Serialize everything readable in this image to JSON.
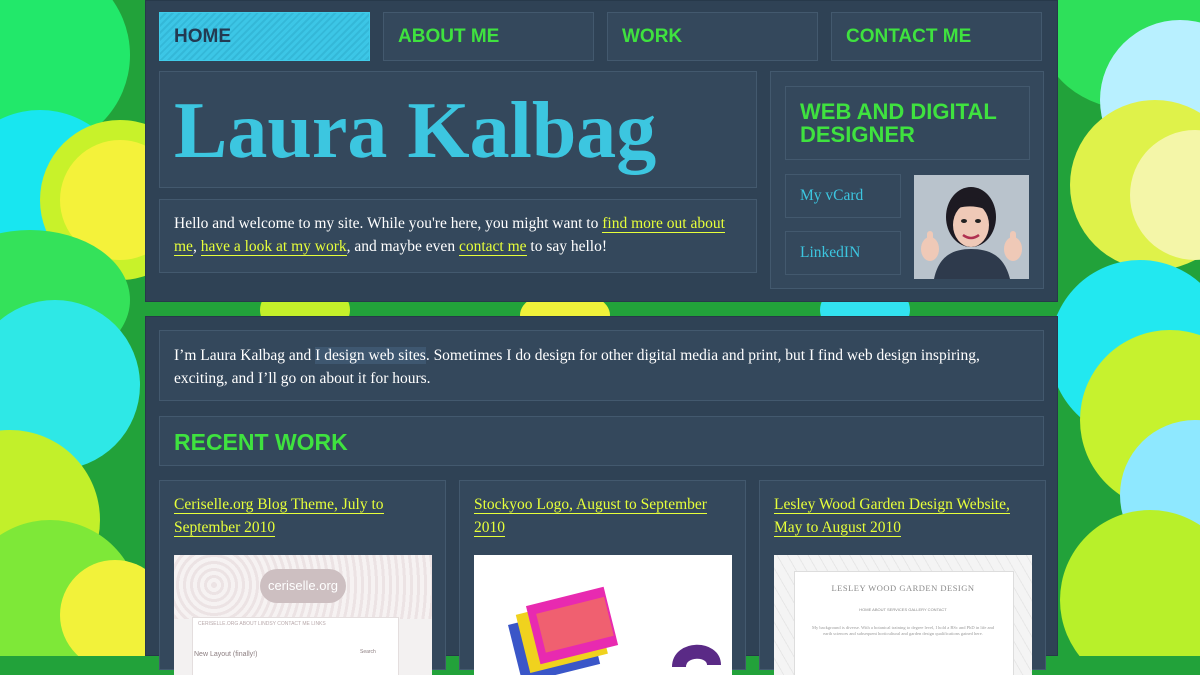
{
  "nav": {
    "home": "HOME",
    "about": "ABOUT ME",
    "work": "WORK",
    "contact": "CONTACT ME"
  },
  "header": {
    "name": "Laura Kalbag",
    "role": "WEB AND DIGITAL DESIGNER",
    "vcard": "My vCard",
    "linkedin": "LinkedIN"
  },
  "intro": {
    "t1": "Hello and welcome to my site. While you're here, you might want to ",
    "l1": "find more out about me",
    "t2": ", ",
    "l2": "have a look at my work",
    "t3": ", and maybe even ",
    "l3": "contact me",
    "t4": " to say hello!"
  },
  "about": {
    "t1": "I’m Laura Kalbag and ",
    "hl": "I design web sites",
    "t2": ". Sometimes I do design for other digital media and print, but I find web design inspiring, exciting, and I’ll go on about it for hours."
  },
  "recent_work": {
    "heading": "RECENT WORK",
    "items": [
      {
        "title": "Ceriselle.org Blog Theme, July to September 2010",
        "thumb_text": "ceriselle.org",
        "thumb_nav": "CERISELLE.ORG   ABOUT LINDSY   CONTACT ME   LINKS",
        "thumb_post": "New Layout (finally!)",
        "thumb_search": "Search"
      },
      {
        "title": "Stockyoo Logo, August to September 2010"
      },
      {
        "title": "Lesley Wood Garden Design Website, May to August 2010",
        "thumb_text": "LESLEY WOOD GARDEN DESIGN",
        "thumb_nav": "HOME    ABOUT    SERVICES    GALLERY    CONTACT",
        "thumb_body": "My background is diverse. With a botanical training to degree level, I hold a BSc and PhD in life and earth sciences and subsequent horticultural and garden design qualifications gained here."
      }
    ]
  },
  "colors": {
    "panel": "#2f4255",
    "green_accent": "#3fe23f",
    "cyan_accent": "#3cc6e0",
    "link_yellow": "#e7ff3a"
  }
}
